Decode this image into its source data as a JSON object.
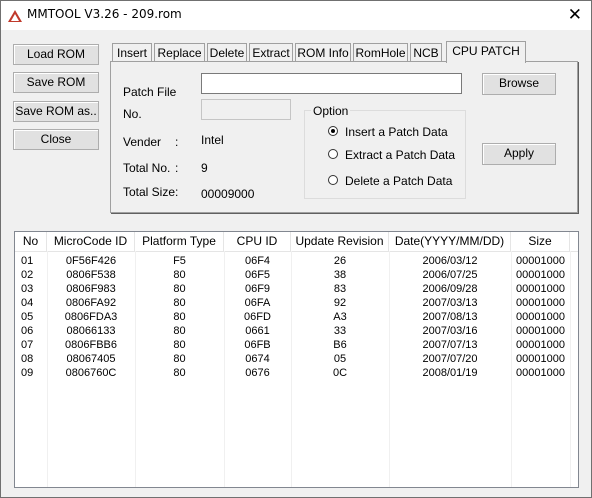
{
  "window": {
    "title": "MMTOOL V3.26 - 209.rom",
    "close_glyph": "✕"
  },
  "left_buttons": {
    "load": "Load ROM",
    "save": "Save ROM",
    "save_as": "Save ROM as..",
    "close": "Close"
  },
  "tabs": [
    "Insert",
    "Replace",
    "Delete",
    "Extract",
    "ROM Info",
    "RomHole",
    "NCB",
    "CPU PATCH"
  ],
  "active_tab": "CPU PATCH",
  "patch": {
    "patch_file_label": "Patch File",
    "patch_file_value": "",
    "no_label": "No.",
    "no_value": "",
    "browse": "Browse",
    "apply": "Apply",
    "vender_label": "Vender",
    "vender_colon": ":",
    "vender_value": "Intel",
    "total_no_label": "Total No.",
    "total_no_colon": ":",
    "total_no_value": "9",
    "total_size_label": "Total Size",
    "total_size_colon": ":",
    "total_size_value": "00009000"
  },
  "option": {
    "title": "Option",
    "items": [
      {
        "label": "Insert a Patch Data",
        "checked": true
      },
      {
        "label": "Extract a Patch Data",
        "checked": false
      },
      {
        "label": "Delete a Patch Data",
        "checked": false
      }
    ]
  },
  "table": {
    "headers": [
      "No",
      "MicroCode ID",
      "Platform Type",
      "CPU ID",
      "Update Revision",
      "Date(YYYY/MM/DD)",
      "Size"
    ],
    "rows": [
      [
        "01",
        "0F56F426",
        "F5",
        "06F4",
        "26",
        "2006/03/12",
        "00001000"
      ],
      [
        "02",
        "0806F538",
        "80",
        "06F5",
        "38",
        "2006/07/25",
        "00001000"
      ],
      [
        "03",
        "0806F983",
        "80",
        "06F9",
        "83",
        "2006/09/28",
        "00001000"
      ],
      [
        "04",
        "0806FA92",
        "80",
        "06FA",
        "92",
        "2007/03/13",
        "00001000"
      ],
      [
        "05",
        "0806FDA3",
        "80",
        "06FD",
        "A3",
        "2007/08/13",
        "00001000"
      ],
      [
        "06",
        "08066133",
        "80",
        "0661",
        "33",
        "2007/03/16",
        "00001000"
      ],
      [
        "07",
        "0806FBB6",
        "80",
        "06FB",
        "B6",
        "2007/07/13",
        "00001000"
      ],
      [
        "08",
        "08067405",
        "80",
        "0674",
        "05",
        "2007/07/20",
        "00001000"
      ],
      [
        "09",
        "0806760C",
        "80",
        "0676",
        "0C",
        "2008/01/19",
        "00001000"
      ]
    ]
  },
  "colors": {
    "app_icon_red": "#c0392b"
  }
}
